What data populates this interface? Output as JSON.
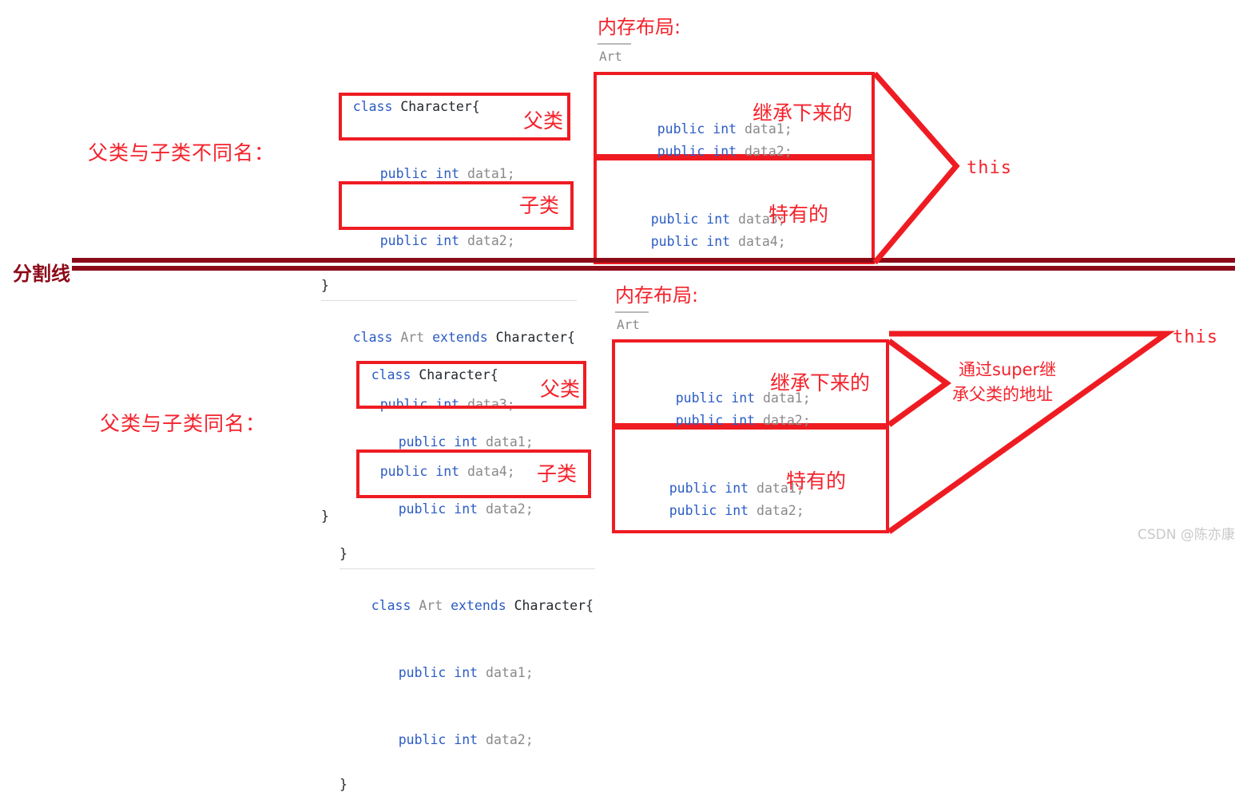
{
  "divider": {
    "label": "分割线",
    "color": "#8c0a18"
  },
  "watermark": {
    "text": "CSDN @陈亦康"
  },
  "accent": {
    "red": "#f4222b",
    "box_red": "#ee1c22",
    "code_blue": "#2b5cc4",
    "gray": "#8a8a8a"
  },
  "sections": [
    {
      "id": "different-names",
      "left_label": "父类与子类不同名：",
      "code": {
        "parent_header": {
          "kw": "class ",
          "name": "Character{"
        },
        "parent_fields": [
          {
            "kw": "public int ",
            "name": "data1;"
          },
          {
            "kw": "public int ",
            "name": "data2;"
          }
        ],
        "parent_close": "}",
        "child_header": {
          "kw1": "class ",
          "cls": "Art ",
          "kw2": "extends ",
          "name": "Character{"
        },
        "child_fields": [
          {
            "kw": "public int ",
            "name": "data3;"
          },
          {
            "kw": "public int ",
            "name": "data4;"
          }
        ],
        "child_close": "}",
        "parent_tag": "父类",
        "child_tag": "子类"
      },
      "memory": {
        "title": "内存布局:",
        "class_name": "Art",
        "upper_fields": [
          {
            "kw": "public int ",
            "name": "data1;"
          },
          {
            "kw": "public int ",
            "name": "data2;"
          }
        ],
        "upper_tag": "继承下来的",
        "lower_fields": [
          {
            "kw": "public int ",
            "name": "data3;"
          },
          {
            "kw": "public int ",
            "name": "data4;"
          }
        ],
        "lower_tag": "特有的",
        "pointer_label": "this"
      }
    },
    {
      "id": "same-names",
      "left_label": "父类与子类同名：",
      "code": {
        "parent_header": {
          "kw": "class ",
          "name": "Character{"
        },
        "parent_fields": [
          {
            "kw": "public int ",
            "name": "data1;"
          },
          {
            "kw": "public int ",
            "name": "data2;"
          }
        ],
        "parent_close": "}",
        "child_header": {
          "kw1": "class ",
          "cls": "Art ",
          "kw2": "extends ",
          "name": "Character{"
        },
        "child_fields": [
          {
            "kw": "public int ",
            "name": "data1;"
          },
          {
            "kw": "public int ",
            "name": "data2;"
          }
        ],
        "child_close": "}",
        "parent_tag": "父类",
        "child_tag": "子类"
      },
      "memory": {
        "title": "内存布局:",
        "class_name": "Art",
        "upper_fields": [
          {
            "kw": "public int ",
            "name": "data1;"
          },
          {
            "kw": "public int ",
            "name": "data2;"
          }
        ],
        "upper_tag": "继承下来的",
        "lower_fields": [
          {
            "kw": "public int ",
            "name": "data1;"
          },
          {
            "kw": "public int ",
            "name": "data2;"
          }
        ],
        "lower_tag": "特有的",
        "pointer_label": "this",
        "super_note_line1": "通过super继",
        "super_note_line2": "承父类的地址"
      }
    }
  ]
}
